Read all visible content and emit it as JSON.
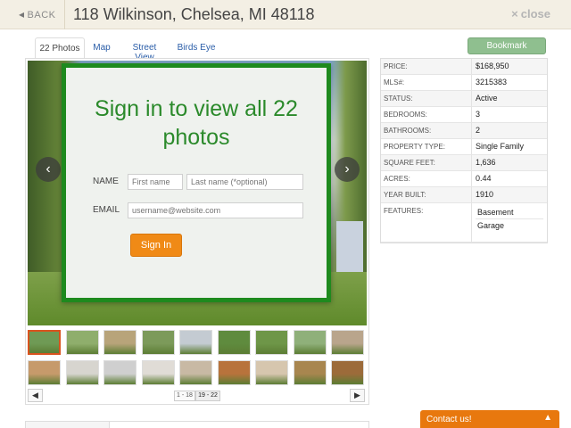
{
  "header": {
    "back_label": "BACK",
    "back_icon": "chevron-left",
    "title": "118 Wilkinson, Chelsea, MI 48118",
    "close_label": "close",
    "close_icon": "x"
  },
  "tabs": [
    {
      "label": "22 Photos",
      "active": true
    },
    {
      "label": "Map",
      "active": false
    },
    {
      "label": "Street View",
      "active": false
    },
    {
      "label": "Birds Eye",
      "active": false
    }
  ],
  "bookmark_label": "Bookmark",
  "signin": {
    "heading": "Sign in to view all 22 photos",
    "name_label": "NAME",
    "first_placeholder": "First name",
    "last_placeholder": "Last name (*optional)",
    "email_label": "EMAIL",
    "email_placeholder": "username@website.com",
    "button_label": "Sign In"
  },
  "gallery": {
    "prev_icon": "‹",
    "next_icon": "›",
    "pages": [
      "1 - 18",
      "19 - 22"
    ],
    "active_page": 1,
    "thumb_colors": [
      "#6f9a55",
      "#8fae6c",
      "#b8a47a",
      "#7c9a5a",
      "#c4cbd2",
      "#5f8b3e",
      "#6e9648",
      "#8fb07a",
      "#b9a58c",
      "#c69a6b",
      "#d7d5cf",
      "#cfcfcf",
      "#e0dcd6",
      "#c8b9a4",
      "#b8733c",
      "#d6c6ae",
      "#a8864f",
      "#9c6b3a"
    ]
  },
  "details": [
    {
      "key": "PRICE:",
      "value": "$168,950"
    },
    {
      "key": "MLS#:",
      "value": "3215383"
    },
    {
      "key": "STATUS:",
      "value": "Active"
    },
    {
      "key": "BEDROOMS:",
      "value": "3"
    },
    {
      "key": "BATHROOMS:",
      "value": "2"
    },
    {
      "key": "PROPERTY TYPE:",
      "value": "Single Family"
    },
    {
      "key": "SQUARE FEET:",
      "value": "1,636"
    },
    {
      "key": "ACRES:",
      "value": "0.44"
    },
    {
      "key": "YEAR BUILT:",
      "value": "1910"
    }
  ],
  "features": {
    "key": "FEATURES:",
    "items": [
      "Basement",
      "Garage"
    ]
  },
  "contact": {
    "label": "Contact us!",
    "icon": "chevron-up"
  },
  "colors": {
    "accent_green": "#1e8a1e",
    "heading_green": "#2b8a2b",
    "button_orange": "#f08a16",
    "contact_orange": "#e8780e",
    "link_blue": "#2a5da8",
    "header_bg": "#f3efe4"
  }
}
